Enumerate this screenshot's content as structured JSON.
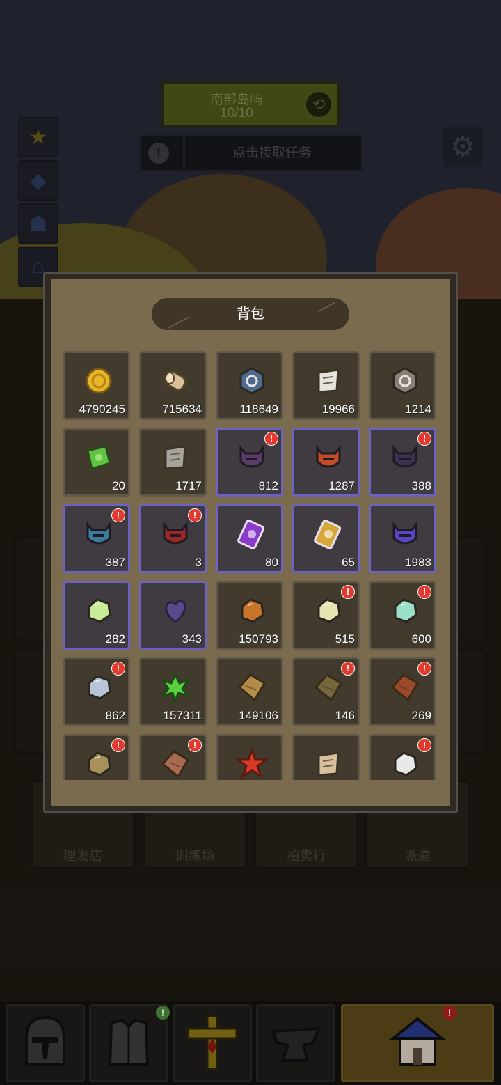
{
  "top_banner": {
    "region_name": "南部岛屿",
    "progress": "10/10"
  },
  "quest_bar": {
    "prompt": "点击接取任务"
  },
  "buildings": [
    "理发店",
    "训练场",
    "拍卖行",
    "派遣"
  ],
  "bag": {
    "title": "背包",
    "items": [
      {
        "icon": "gold-coin-icon",
        "count": "4790245",
        "badge": false,
        "rare": false,
        "color": "#e6b52a"
      },
      {
        "icon": "wood-log-icon",
        "count": "715634",
        "badge": false,
        "rare": false,
        "color": "#d9c19a"
      },
      {
        "icon": "blue-gear-stone-icon",
        "count": "118649",
        "badge": false,
        "rare": false,
        "color": "#4e6b8c"
      },
      {
        "icon": "scroll-icon",
        "count": "19966",
        "badge": false,
        "rare": false,
        "color": "#e6e2dc"
      },
      {
        "icon": "stone-rune-icon",
        "count": "1214",
        "badge": false,
        "rare": false,
        "color": "#8a7e78"
      },
      {
        "icon": "green-ticket-icon",
        "count": "20",
        "badge": false,
        "rare": false,
        "color": "#5ec442"
      },
      {
        "icon": "blueprint-icon",
        "count": "1717",
        "badge": false,
        "rare": false,
        "color": "#a8a49c"
      },
      {
        "icon": "purple-armor-icon",
        "count": "812",
        "badge": true,
        "rare": true,
        "color": "#5a3c6a"
      },
      {
        "icon": "orange-armor-icon",
        "count": "1287",
        "badge": false,
        "rare": true,
        "color": "#c24c24"
      },
      {
        "icon": "dark-helmet-icon",
        "count": "388",
        "badge": true,
        "rare": true,
        "color": "#3e3050"
      },
      {
        "icon": "blue-helmet-icon",
        "count": "387",
        "badge": true,
        "rare": true,
        "color": "#3c7a9a"
      },
      {
        "icon": "red-armor-icon",
        "count": "3",
        "badge": true,
        "rare": true,
        "color": "#9a2828"
      },
      {
        "icon": "purple-card-icon",
        "count": "80",
        "badge": false,
        "rare": true,
        "color": "#8a3cc8"
      },
      {
        "icon": "gold-card-icon",
        "count": "65",
        "badge": false,
        "rare": true,
        "color": "#d6a83c"
      },
      {
        "icon": "purple-horn-helmet-icon",
        "count": "1983",
        "badge": false,
        "rare": true,
        "color": "#5a44c4"
      },
      {
        "icon": "light-green-gem-icon",
        "count": "282",
        "badge": false,
        "rare": true,
        "color": "#c8ec9a"
      },
      {
        "icon": "purple-heart-icon",
        "count": "343",
        "badge": false,
        "rare": true,
        "color": "#5a4a8c"
      },
      {
        "icon": "orange-ore-icon",
        "count": "150793",
        "badge": false,
        "rare": false,
        "color": "#c8742a"
      },
      {
        "icon": "pale-ore-icon",
        "count": "515",
        "badge": true,
        "rare": false,
        "color": "#e6e4b0"
      },
      {
        "icon": "teal-crystal-icon",
        "count": "600",
        "badge": true,
        "rare": false,
        "color": "#9ae0c8"
      },
      {
        "icon": "silver-ore-icon",
        "count": "862",
        "badge": true,
        "rare": false,
        "color": "#b8c4d8"
      },
      {
        "icon": "green-leaf-icon",
        "count": "157311",
        "badge": false,
        "rare": false,
        "color": "#5ad040"
      },
      {
        "icon": "tan-leather-icon",
        "count": "149106",
        "badge": false,
        "rare": false,
        "color": "#b48c4a"
      },
      {
        "icon": "olive-leather-icon",
        "count": "146",
        "badge": true,
        "rare": false,
        "color": "#74683e"
      },
      {
        "icon": "red-leather-icon",
        "count": "269",
        "badge": true,
        "rare": false,
        "color": "#9a4a2a"
      },
      {
        "icon": "sand-ore-icon",
        "count": "",
        "badge": true,
        "rare": false,
        "color": "#a8905a"
      },
      {
        "icon": "brick-icon",
        "count": "",
        "badge": true,
        "rare": false,
        "color": "#a86a50"
      },
      {
        "icon": "red-star-ore-icon",
        "count": "",
        "badge": false,
        "rare": false,
        "color": "#d83a28"
      },
      {
        "icon": "cloth-icon",
        "count": "",
        "badge": false,
        "rare": false,
        "color": "#d8c09a"
      },
      {
        "icon": "white-ore-icon",
        "count": "",
        "badge": true,
        "rare": false,
        "color": "#e8e8e8"
      }
    ]
  },
  "dock": [
    {
      "name": "helmet-tab",
      "icon": "knight-helmet-icon",
      "active": false,
      "badge": false
    },
    {
      "name": "armor-tab",
      "icon": "chest-armor-icon",
      "active": false,
      "badge": true
    },
    {
      "name": "cross-tab",
      "icon": "golden-cross-icon",
      "active": false,
      "badge": false
    },
    {
      "name": "anvil-tab",
      "icon": "anvil-icon",
      "active": false,
      "badge": false
    },
    {
      "name": "town-tab",
      "icon": "town-house-icon",
      "active": true,
      "badge": true
    }
  ]
}
